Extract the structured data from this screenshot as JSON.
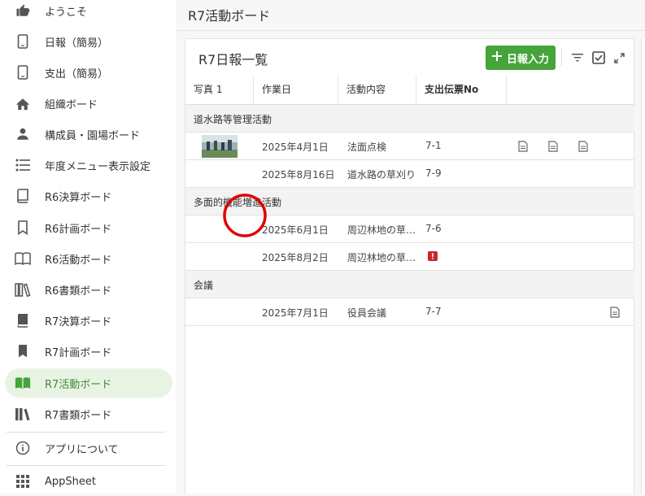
{
  "sidebar": {
    "items": [
      {
        "label": "ようこそ",
        "icon": "thumbs-up-icon",
        "active": false
      },
      {
        "label": "日報（簡易）",
        "icon": "phone-icon",
        "active": false
      },
      {
        "label": "支出（簡易）",
        "icon": "phone-icon",
        "active": false
      },
      {
        "label": "組織ボード",
        "icon": "home-icon",
        "active": false
      },
      {
        "label": "構成員・園場ボード",
        "icon": "person-icon",
        "active": false
      },
      {
        "label": "年度メニュー表示設定",
        "icon": "list-icon",
        "active": false
      },
      {
        "label": "R6決算ボード",
        "icon": "book-outline-icon",
        "active": false
      },
      {
        "label": "R6計画ボード",
        "icon": "bookmark-outline-icon",
        "active": false
      },
      {
        "label": "R6活動ボード",
        "icon": "open-book-outline-icon",
        "active": false
      },
      {
        "label": "R6書類ボード",
        "icon": "library-outline-icon",
        "active": false
      },
      {
        "label": "R7決算ボード",
        "icon": "book-filled-icon",
        "active": false
      },
      {
        "label": "R7計画ボード",
        "icon": "bookmark-filled-icon",
        "active": false
      },
      {
        "label": "R7活動ボード",
        "icon": "open-book-filled-icon",
        "active": true
      },
      {
        "label": "R7書類ボード",
        "icon": "library-filled-icon",
        "active": false
      }
    ],
    "about_label": "アプリについて",
    "appsheet_label": "AppSheet"
  },
  "header": {
    "title": "R7活動ボード"
  },
  "card": {
    "title": "R7日報一覧",
    "add_button_label": "日報入力",
    "columns": [
      "写真 1",
      "作業日",
      "活動内容",
      "支出伝票No"
    ],
    "groups": [
      {
        "name": "道水路等管理活動",
        "rows": [
          {
            "has_photo": true,
            "date": "2025年4月1日",
            "activity": "法面点検",
            "voucher": "7-1",
            "docs": 3
          },
          {
            "has_photo": false,
            "date": "2025年8月16日",
            "activity": "道水路の草刈り",
            "voucher": "7-9",
            "docs": 0
          }
        ]
      },
      {
        "name": "多面的機能増進活動",
        "rows": [
          {
            "has_photo": false,
            "date": "2025年6月1日",
            "activity": "周辺林地の草…",
            "voucher": "7-6",
            "docs": 0
          },
          {
            "has_photo": false,
            "date": "2025年8月2日",
            "activity": "周辺林地の草…",
            "voucher": "",
            "docs": 0,
            "error": true
          }
        ]
      },
      {
        "name": "会議",
        "rows": [
          {
            "has_photo": false,
            "date": "2025年7月1日",
            "activity": "役員会議",
            "voucher": "7-7",
            "docs": 1
          }
        ]
      }
    ]
  },
  "colors": {
    "accent": "#46a43a",
    "active_bg": "#e9f3e4",
    "error": "#c62828",
    "annotation": "#e00000"
  }
}
